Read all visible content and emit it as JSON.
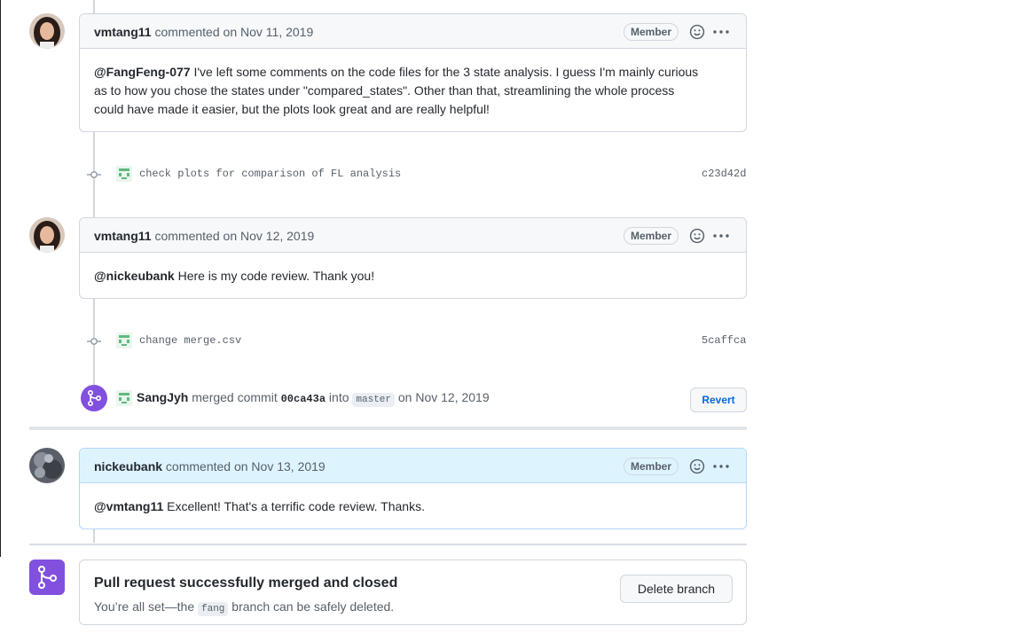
{
  "comments": [
    {
      "author": "vmtang11",
      "commented": "commented",
      "date": "on Nov 11, 2019",
      "badge": "Member",
      "mention": "@FangFeng-077",
      "body_line1": " I've left some comments on the code files for the 3 state analysis. I guess I'm mainly curious",
      "body_line2": "as to how you chose the states under \"compared_states\". Other than that, streamlining the whole process",
      "body_line3": "could have made it easier, but the plots look great and are really helpful!"
    },
    {
      "author": "vmtang11",
      "commented": "commented",
      "date": "on Nov 12, 2019",
      "badge": "Member",
      "mention": "@nickeubank",
      "body_line1": " Here is my code review. Thank you!"
    },
    {
      "author": "nickeubank",
      "commented": "commented",
      "date": "on Nov 13, 2019",
      "badge": "Member",
      "mention": "@vmtang11",
      "body_line1": " Excellent! That's a terrific code review. Thanks."
    }
  ],
  "commits": [
    {
      "message": "check plots for comparison of FL analysis",
      "sha": "c23d42d"
    },
    {
      "message": "change merge.csv",
      "sha": "5caffca"
    }
  ],
  "merge_event": {
    "actor": "SangJyh",
    "text_merged": " merged commit ",
    "commit": "00ca43a",
    "text_into": " into ",
    "branch": "master",
    "date": " on Nov 12, 2019",
    "revert_label": "Revert"
  },
  "merged_box": {
    "title": "Pull request successfully merged and closed",
    "text_before": "You’re all set—the ",
    "branch": "fang",
    "text_after": " branch can be safely deleted.",
    "delete_label": "Delete branch"
  },
  "colors": {
    "merged_purple": "#8250df",
    "link_blue": "#0969da",
    "border": "#d0d7de"
  }
}
